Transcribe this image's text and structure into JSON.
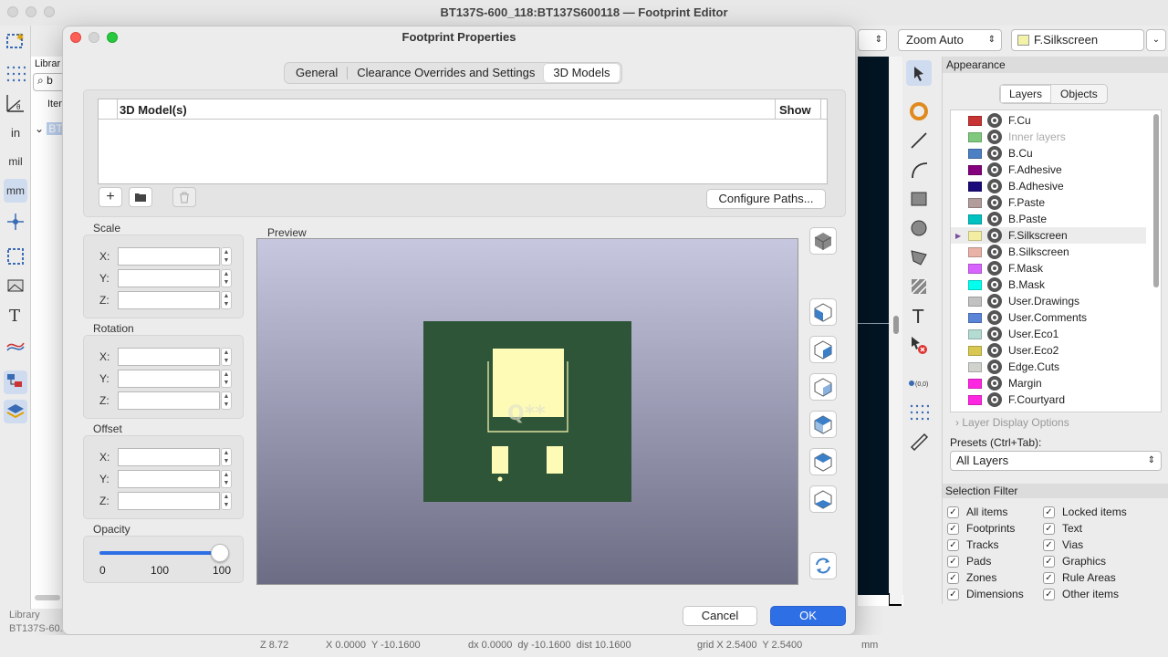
{
  "window": {
    "title": "BT137S-600_118:BT137S600118 — Footprint Editor"
  },
  "toolbar_left": {
    "items": [
      {
        "icon": "new-footprint-icon"
      },
      {
        "icon": "footprint-wizard-icon"
      },
      {
        "icon": "grid-dots-icon"
      },
      {
        "icon": "polar-coords-icon",
        "label": "r θ"
      },
      {
        "icon": "units-inch-icon",
        "label": "in"
      },
      {
        "icon": "units-mil-icon",
        "label": "mil"
      },
      {
        "icon": "units-mm-icon",
        "label": "mm"
      },
      {
        "icon": "cursor-crosshair-icon"
      },
      {
        "icon": "pad-outline-icon"
      },
      {
        "icon": "graphics-outline-icon"
      },
      {
        "icon": "text-outline-icon"
      },
      {
        "icon": "ratsnest-icon"
      },
      {
        "icon": "tree-icon"
      },
      {
        "icon": "layers-icon"
      }
    ]
  },
  "library_panel": {
    "header": "Librar",
    "search_value": "b",
    "column": "Item",
    "tree_item": "BT",
    "footer_label": "Library",
    "footer_value": "BT137S-60..."
  },
  "toolbar_top_right": {
    "grid_select": "",
    "zoom_select": "Zoom Auto",
    "layer_select": "F.Silkscreen",
    "layer_color": "#f2f2a8"
  },
  "appearance": {
    "title": "Appearance",
    "tabs": [
      "Layers",
      "Objects"
    ],
    "layers": [
      {
        "name": "F.Cu",
        "color": "#c83434",
        "dim": false
      },
      {
        "name": "Inner layers",
        "color": "#7fc97f",
        "dim": true
      },
      {
        "name": "B.Cu",
        "color": "#4d7fc4",
        "dim": false
      },
      {
        "name": "F.Adhesive",
        "color": "#84007c",
        "dim": false
      },
      {
        "name": "B.Adhesive",
        "color": "#1a0a7a",
        "dim": false
      },
      {
        "name": "F.Paste",
        "color": "#b29c9c",
        "dim": false
      },
      {
        "name": "B.Paste",
        "color": "#00c2c2",
        "dim": false
      },
      {
        "name": "F.Silkscreen",
        "color": "#f2eda1",
        "dim": false,
        "selected": true
      },
      {
        "name": "B.Silkscreen",
        "color": "#e8b2a7",
        "dim": false
      },
      {
        "name": "F.Mask",
        "color": "#d864ff",
        "dim": false
      },
      {
        "name": "B.Mask",
        "color": "#02ffee",
        "dim": false
      },
      {
        "name": "User.Drawings",
        "color": "#c2c2c2",
        "dim": false
      },
      {
        "name": "User.Comments",
        "color": "#5984d8",
        "dim": false
      },
      {
        "name": "User.Eco1",
        "color": "#b4dbd2",
        "dim": false
      },
      {
        "name": "User.Eco2",
        "color": "#d8c852",
        "dim": false
      },
      {
        "name": "Edge.Cuts",
        "color": "#d0d2cd",
        "dim": false
      },
      {
        "name": "Margin",
        "color": "#ff26e2",
        "dim": false
      },
      {
        "name": "F.Courtyard",
        "color": "#ff26e2",
        "dim": false
      }
    ],
    "layer_display_options": "Layer Display Options",
    "presets_label": "Presets (Ctrl+Tab):",
    "presets_value": "All Layers"
  },
  "selection_filter": {
    "title": "Selection Filter",
    "left": [
      "All items",
      "Footprints",
      "Tracks",
      "Pads",
      "Zones",
      "Dimensions"
    ],
    "right": [
      "Locked items",
      "Text",
      "Vias",
      "Graphics",
      "Rule Areas",
      "Other items"
    ]
  },
  "dialog": {
    "title": "Footprint Properties",
    "tabs": [
      "General",
      "Clearance Overrides and Settings",
      "3D Models"
    ],
    "active_tab": "3D Models",
    "models_table": {
      "col_model": "3D Model(s)",
      "col_show": "Show"
    },
    "configure_paths": "Configure Paths...",
    "scale": {
      "label": "Scale",
      "x_label": "X:",
      "y_label": "Y:",
      "z_label": "Z:",
      "x": "",
      "y": "",
      "z": ""
    },
    "rotation": {
      "label": "Rotation",
      "x_label": "X:",
      "y_label": "Y:",
      "z_label": "Z:",
      "x": "",
      "y": "",
      "z": ""
    },
    "offset": {
      "label": "Offset",
      "x_label": "X:",
      "y_label": "Y:",
      "z_label": "Z:",
      "x": "",
      "y": "",
      "z": ""
    },
    "opacity": {
      "label": "Opacity",
      "min": "0",
      "max": "100",
      "value": "100",
      "fraction": 1.0
    },
    "preview_label": "Preview",
    "preview_ref_text": "Q**",
    "cancel": "Cancel",
    "ok": "OK"
  },
  "statusbar": {
    "zoom": "Z 8.72",
    "coords": "X 0.0000  Y -10.1600",
    "delta": "dx 0.0000  dy -10.1600  dist 10.1600",
    "grid": "grid X 2.5400  Y 2.5400",
    "units": "mm"
  }
}
